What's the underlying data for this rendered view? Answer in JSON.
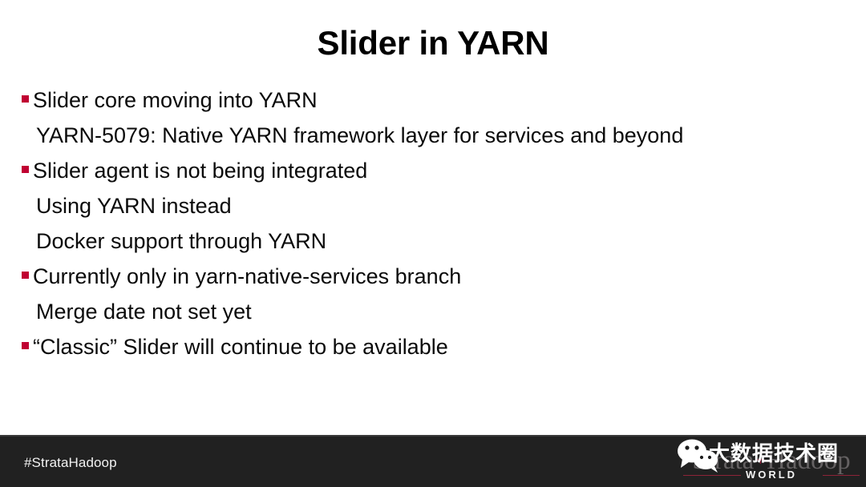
{
  "slide": {
    "title": "Slider in YARN",
    "background_color": "#ffffff",
    "text_color": "#0a0a0a",
    "bullet_color": "#C00032",
    "lines": [
      {
        "level": 1,
        "bullet": true,
        "text": "Slider core moving into YARN"
      },
      {
        "level": 2,
        "bullet": false,
        "text": "YARN-5079: Native YARN framework layer for services and beyond"
      },
      {
        "level": 1,
        "bullet": true,
        "text": "Slider agent is not being integrated"
      },
      {
        "level": 2,
        "bullet": false,
        "text": "Using YARN instead"
      },
      {
        "level": 2,
        "bullet": false,
        "text": "Docker support through YARN"
      },
      {
        "level": 1,
        "bullet": true,
        "text": "Currently only in yarn-native-services branch"
      },
      {
        "level": 2,
        "bullet": false,
        "text": "Merge date not set yet"
      },
      {
        "level": 1,
        "bullet": true,
        "text": "“Classic” Slider will continue to be available"
      }
    ]
  },
  "footer": {
    "background_color": "#212121",
    "hashtag": "#StrataHadoop",
    "logo": {
      "strata_word": "Strata",
      "plus": "+",
      "hadoop_word": "Hadoop",
      "world": "WORLD",
      "accent_color": "#b5123c",
      "wechat_overlay_text": "大数据技术圈",
      "wechat_icon_name": "wechat-icon"
    }
  }
}
